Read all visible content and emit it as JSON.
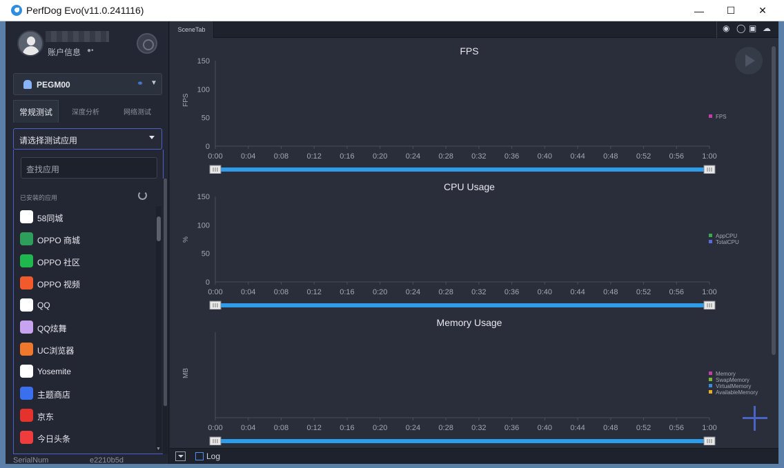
{
  "window": {
    "title": "PerfDog Evo(v11.0.241116)",
    "minimize": "—",
    "maximize": "☐",
    "close": "✕"
  },
  "account": {
    "label": "账户信息"
  },
  "device": {
    "name": "PEGM00"
  },
  "tabs": [
    {
      "label": "常规测试"
    },
    {
      "label": "深度分析"
    },
    {
      "label": "网络测试"
    }
  ],
  "app_select": {
    "value": "请选择测试应用",
    "search_placeholder": "查找应用",
    "installed_label": "已安装的应用"
  },
  "apps": [
    {
      "label": "58同城",
      "icon": "58-app-icon",
      "color": "#ffffff"
    },
    {
      "label": "OPPO 商城",
      "icon": "oppo-store-icon",
      "color": "#2e9f5a"
    },
    {
      "label": "OPPO 社区",
      "icon": "oppo-community-icon",
      "color": "#1fb84f"
    },
    {
      "label": "OPPO 视频",
      "icon": "oppo-video-icon",
      "color": "#f25a2c"
    },
    {
      "label": "QQ",
      "icon": "qq-icon",
      "color": "#ffffff"
    },
    {
      "label": "QQ炫舞",
      "icon": "qq-dance-icon",
      "color": "#c8a4f0"
    },
    {
      "label": "UC浏览器",
      "icon": "uc-browser-icon",
      "color": "#f0782c"
    },
    {
      "label": "Yosemite",
      "icon": "yosemite-icon",
      "color": "#ffffff"
    },
    {
      "label": "主题商店",
      "icon": "theme-store-icon",
      "color": "#3a6ff0"
    },
    {
      "label": "京东",
      "icon": "jd-icon",
      "color": "#e5322d"
    },
    {
      "label": "今日头条",
      "icon": "toutiao-icon",
      "color": "#f03c3c"
    }
  ],
  "serial": {
    "key": "SerialNum",
    "value": "e2210b5d"
  },
  "scene_tab": "SceneTab",
  "log_label": "Log",
  "x_ticks": [
    "0:00",
    "0:04",
    "0:08",
    "0:12",
    "0:16",
    "0:20",
    "0:24",
    "0:28",
    "0:32",
    "0:36",
    "0:40",
    "0:44",
    "0:48",
    "0:52",
    "0:56",
    "1:00"
  ],
  "charts": [
    {
      "title": "FPS",
      "ylabel": "FPS",
      "yticks": [
        "150",
        "100",
        "50",
        "0"
      ],
      "legend": [
        {
          "name": "FPS",
          "color": "#c23fa6"
        }
      ]
    },
    {
      "title": "CPU Usage",
      "ylabel": "%",
      "yticks": [
        "150",
        "100",
        "50",
        "0"
      ],
      "legend": [
        {
          "name": "AppCPU",
          "color": "#3aa84f"
        },
        {
          "name": "TotalCPU",
          "color": "#5a6ad8"
        }
      ]
    },
    {
      "title": "Memory Usage",
      "ylabel": "MB",
      "yticks": [],
      "legend": [
        {
          "name": "Memory",
          "color": "#c23fa6"
        },
        {
          "name": "SwapMemory",
          "color": "#7ab830"
        },
        {
          "name": "VirtualMemory",
          "color": "#3a8ad8"
        },
        {
          "name": "AvailableMemory",
          "color": "#e8b020"
        }
      ]
    }
  ],
  "chart_data": [
    {
      "type": "line",
      "title": "FPS",
      "xlabel": "",
      "ylabel": "FPS",
      "ylim": [
        0,
        150
      ],
      "x": [
        "0:00",
        "0:04",
        "0:08",
        "0:12",
        "0:16",
        "0:20",
        "0:24",
        "0:28",
        "0:32",
        "0:36",
        "0:40",
        "0:44",
        "0:48",
        "0:52",
        "0:56",
        "1:00"
      ],
      "series": [
        {
          "name": "FPS",
          "values": []
        }
      ]
    },
    {
      "type": "line",
      "title": "CPU Usage",
      "xlabel": "",
      "ylabel": "%",
      "ylim": [
        0,
        150
      ],
      "x": [
        "0:00",
        "0:04",
        "0:08",
        "0:12",
        "0:16",
        "0:20",
        "0:24",
        "0:28",
        "0:32",
        "0:36",
        "0:40",
        "0:44",
        "0:48",
        "0:52",
        "0:56",
        "1:00"
      ],
      "series": [
        {
          "name": "AppCPU",
          "values": []
        },
        {
          "name": "TotalCPU",
          "values": []
        }
      ]
    },
    {
      "type": "line",
      "title": "Memory Usage",
      "xlabel": "",
      "ylabel": "MB",
      "x": [
        "0:00",
        "0:04",
        "0:08",
        "0:12",
        "0:16",
        "0:20",
        "0:24",
        "0:28",
        "0:32",
        "0:36",
        "0:40",
        "0:44",
        "0:48",
        "0:52",
        "0:56",
        "1:00"
      ],
      "series": [
        {
          "name": "Memory",
          "values": []
        },
        {
          "name": "SwapMemory",
          "values": []
        },
        {
          "name": "VirtualMemory",
          "values": []
        },
        {
          "name": "AvailableMemory",
          "values": []
        }
      ]
    }
  ]
}
